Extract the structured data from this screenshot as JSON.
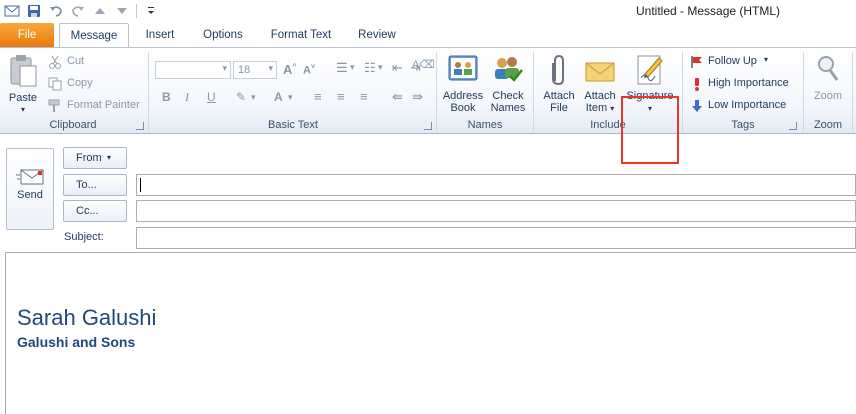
{
  "window": {
    "title": "Untitled  -  Message (HTML)"
  },
  "tabs": [
    {
      "label": "File"
    },
    {
      "label": "Message"
    },
    {
      "label": "Insert"
    },
    {
      "label": "Options"
    },
    {
      "label": "Format Text"
    },
    {
      "label": "Review"
    }
  ],
  "ribbon": {
    "clipboard": {
      "paste": "Paste",
      "cut": "Cut",
      "copy": "Copy",
      "format_painter": "Format Painter",
      "label": "Clipboard"
    },
    "basic_text": {
      "font_size": "18",
      "label": "Basic Text"
    },
    "names": {
      "address_book_line1": "Address",
      "address_book_line2": "Book",
      "check_names_line1": "Check",
      "check_names_line2": "Names",
      "label": "Names"
    },
    "include": {
      "attach_file_line1": "Attach",
      "attach_file_line2": "File",
      "attach_item_line1": "Attach",
      "attach_item_line2": "Item",
      "signature": "Signature",
      "label": "Include"
    },
    "tags": {
      "follow_up": "Follow Up",
      "high_importance": "High Importance",
      "low_importance": "Low Importance",
      "label": "Tags"
    },
    "zoom": {
      "zoom": "Zoom",
      "label": "Zoom"
    }
  },
  "compose": {
    "send": "Send",
    "from": "From",
    "to": "To...",
    "cc": "Cc...",
    "subject": "Subject:"
  },
  "message_body": {
    "signature_name": "Sarah Galushi",
    "signature_company": "Galushi and Sons"
  }
}
